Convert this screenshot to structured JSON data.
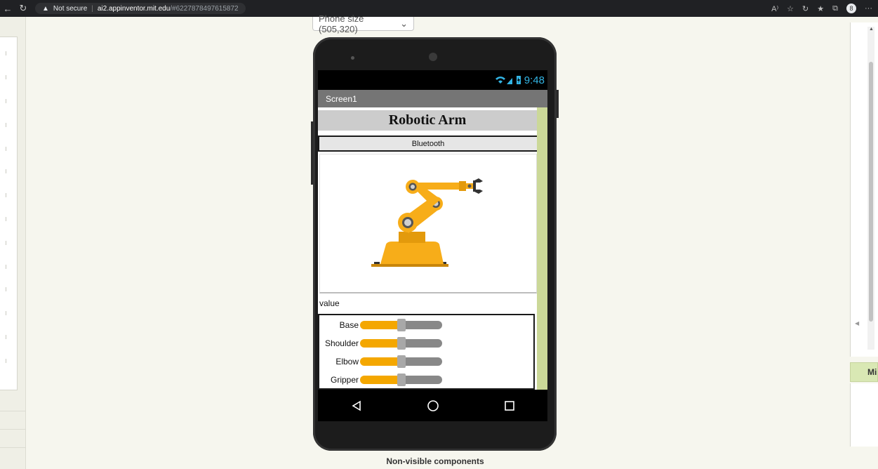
{
  "browser": {
    "back": "←",
    "reload": "C",
    "security_label": "Not secure",
    "host": "ai2.appinventor.mit.edu",
    "path": "/#6227878497615872",
    "more": "···",
    "profile_initial": "8"
  },
  "designer": {
    "size_select": "Phone size (505,320)",
    "nonvisible_label": "Non-visible components",
    "right_tab_label": "Mi"
  },
  "phone": {
    "status_time": "9:48",
    "screen_title": "Screen1",
    "heading": "Robotic Arm",
    "bluetooth_button": "Bluetooth",
    "value_label": "value",
    "sliders": [
      {
        "label": "Base",
        "value": 0.5
      },
      {
        "label": "Shoulder",
        "value": 0.5
      },
      {
        "label": "Elbow",
        "value": 0.5
      },
      {
        "label": "Gripper",
        "value": 0.5
      }
    ]
  },
  "colors": {
    "slider_fill": "#f4a700",
    "slider_track": "#888888",
    "screen_scroll": "#cbd898",
    "accent_blue": "#33b5e5"
  }
}
